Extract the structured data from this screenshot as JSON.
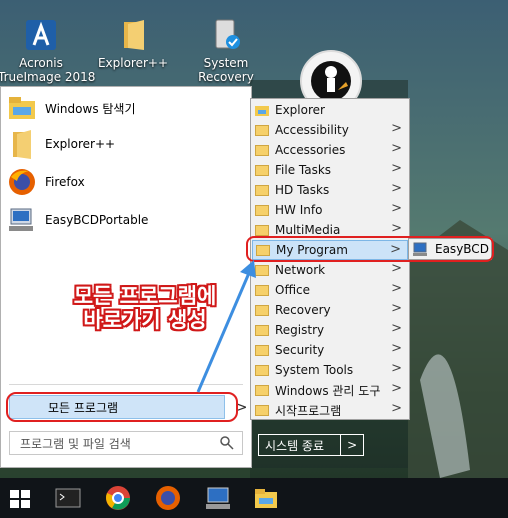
{
  "desktop": {
    "icons": [
      {
        "label": "Acronis\nTrueImage 2018",
        "icon": "acronis-icon"
      },
      {
        "label": "Explorer++",
        "icon": "folder-icon"
      },
      {
        "label": "System\nRecovery",
        "icon": "system-recovery-icon"
      }
    ]
  },
  "start_menu": {
    "pinned": [
      {
        "label": "Windows 탐색기",
        "icon": "file-explorer-icon"
      },
      {
        "label": "Explorer++",
        "icon": "folder-icon"
      },
      {
        "label": "Firefox",
        "icon": "firefox-icon"
      },
      {
        "label": "EasyBCDPortable",
        "icon": "easybcd-icon"
      }
    ],
    "all_programs_label": "모든 프로그램",
    "search_placeholder": "프로그램 및 파일 검색",
    "shutdown_label": "시스템 종료",
    "shutdown_arrow": ">"
  },
  "programs_menu": {
    "items": [
      {
        "label": "Explorer",
        "has_submenu": false,
        "icon": "file-explorer-icon"
      },
      {
        "label": "Accessibility",
        "has_submenu": true
      },
      {
        "label": "Accessories",
        "has_submenu": true
      },
      {
        "label": "File Tasks",
        "has_submenu": true
      },
      {
        "label": "HD Tasks",
        "has_submenu": true
      },
      {
        "label": "HW Info",
        "has_submenu": true
      },
      {
        "label": "MultiMedia",
        "has_submenu": true
      },
      {
        "label": "My Program",
        "has_submenu": true,
        "highlighted": true
      },
      {
        "label": "Network",
        "has_submenu": true
      },
      {
        "label": "Office",
        "has_submenu": true
      },
      {
        "label": "Recovery",
        "has_submenu": true
      },
      {
        "label": "Registry",
        "has_submenu": true
      },
      {
        "label": "Security",
        "has_submenu": true
      },
      {
        "label": "System Tools",
        "has_submenu": true
      },
      {
        "label": "Windows 관리 도구",
        "has_submenu": true
      },
      {
        "label": "시작프로그램",
        "has_submenu": true
      }
    ],
    "submenu_arrow": ">"
  },
  "submenu": {
    "label": "EasyBCD",
    "icon": "easybcd-icon"
  },
  "annotation": {
    "text": "모든 프로그램에\n바로가기 생성",
    "color": "#d01818"
  },
  "taskbar": {
    "items": [
      "windows-start-icon",
      "terminal-icon",
      "chrome-icon",
      "firefox-icon",
      "easybcd-icon",
      "folder-icon"
    ]
  },
  "colors": {
    "highlight": "#cce3f8",
    "annotation_red": "#e02020",
    "arrow_blue": "#3d8ee0"
  }
}
